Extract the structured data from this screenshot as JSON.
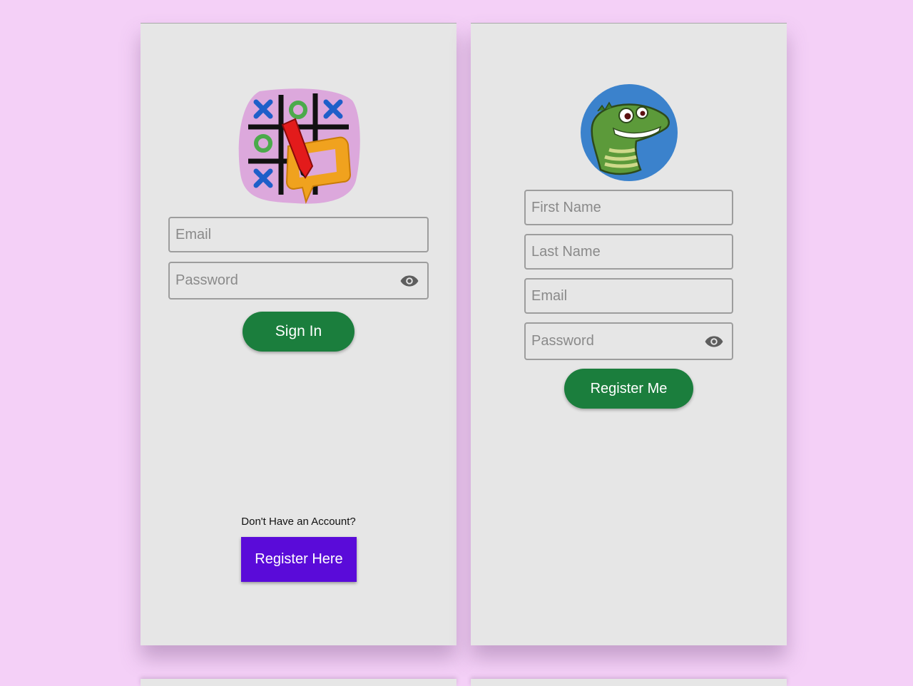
{
  "login": {
    "email_placeholder": "Email",
    "password_placeholder": "Password",
    "sign_in_label": "Sign In",
    "no_account_text": "Don't Have an Account?",
    "register_here_label": "Register Here"
  },
  "register": {
    "first_name_placeholder": "First Name",
    "last_name_placeholder": "Last Name",
    "email_placeholder": "Email",
    "password_placeholder": "Password",
    "register_me_label": "Register Me"
  },
  "colors": {
    "background": "#f4d0f7",
    "screen": "#e6e6e6",
    "primary_button": "#1b7e3d",
    "register_here_button": "#5a0bd9",
    "logo_circle": "#3b82cc"
  },
  "icons": {
    "app_logo": "tic-tac-toe-logo-icon",
    "avatar": "crocodile-avatar-icon",
    "password_toggle": "eye-icon"
  }
}
